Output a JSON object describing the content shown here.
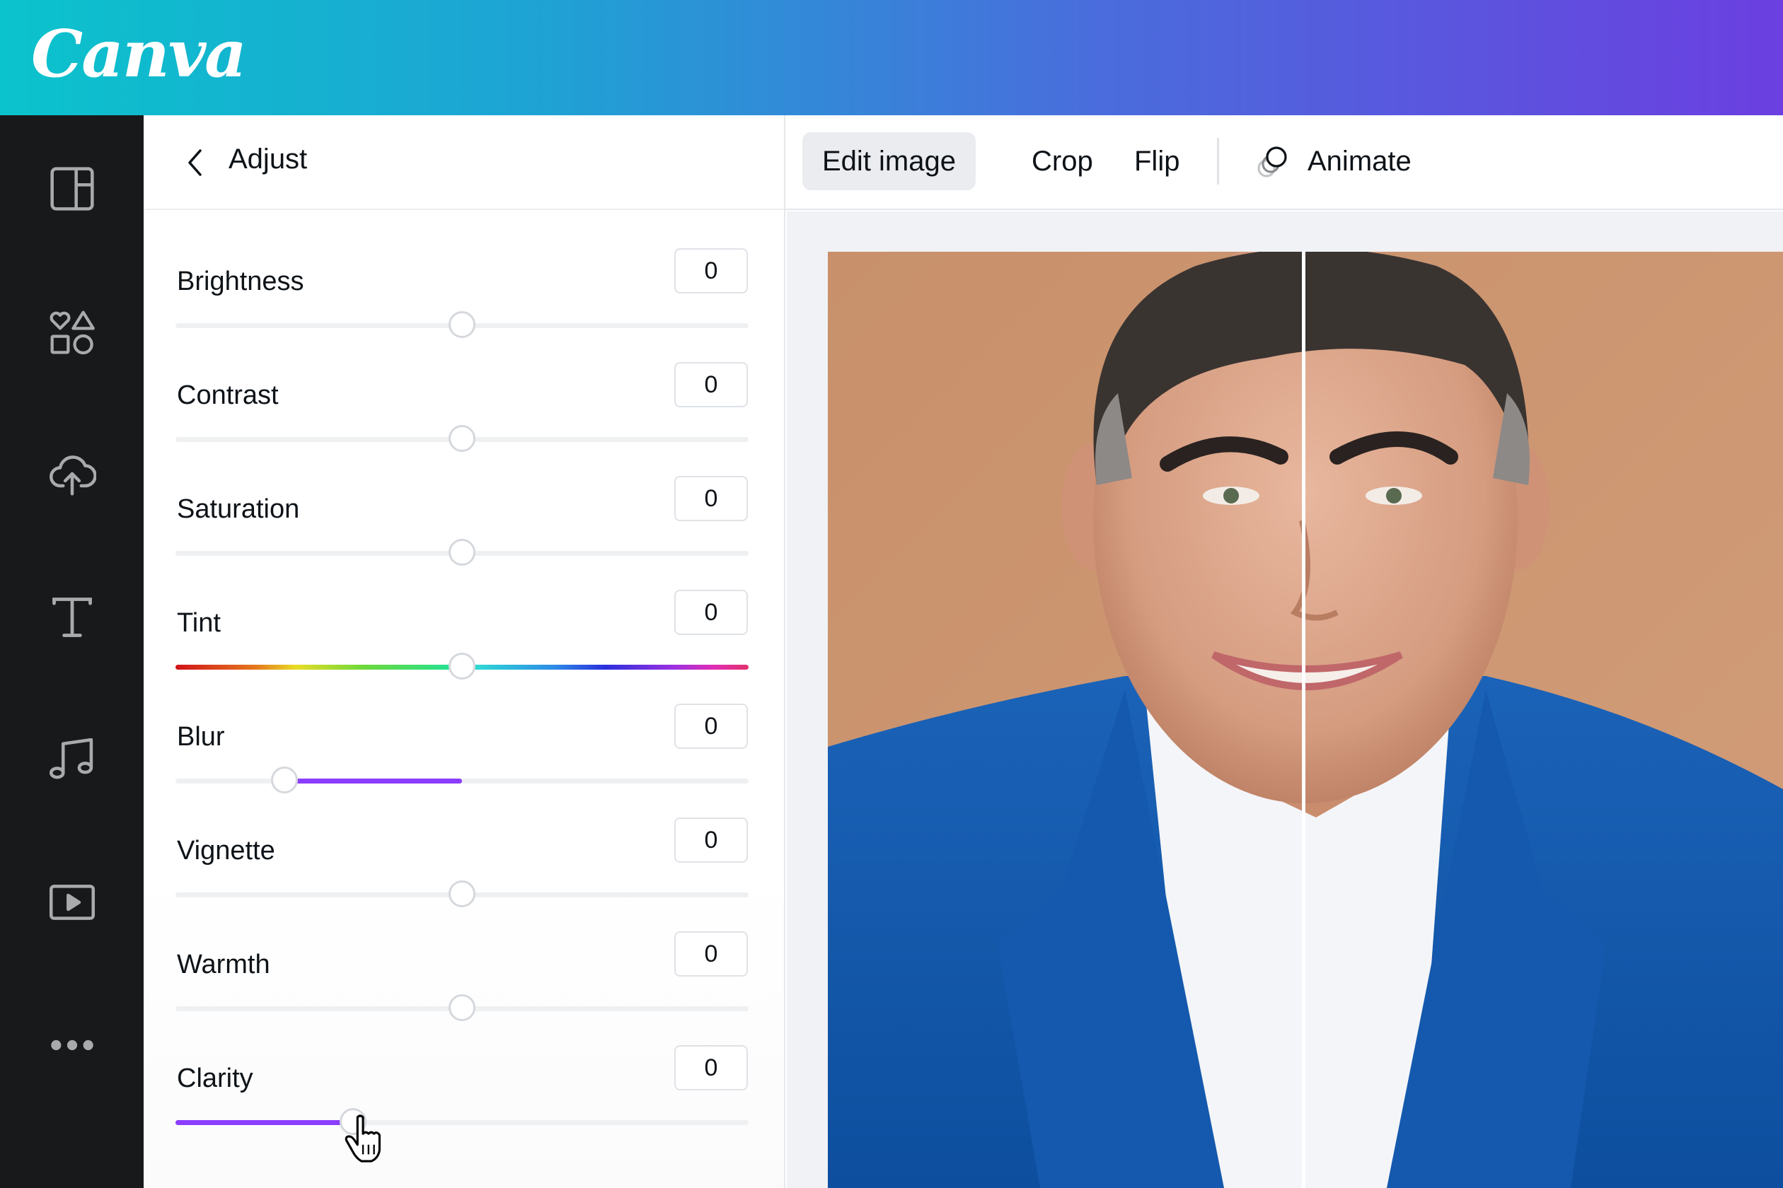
{
  "app": {
    "brand": "Canva",
    "header_gradient": [
      "#0bc3cc",
      "#6b3fe0"
    ]
  },
  "sidebar": {
    "items": [
      {
        "name": "templates",
        "icon": "layout-icon"
      },
      {
        "name": "elements",
        "icon": "shapes-icon"
      },
      {
        "name": "uploads",
        "icon": "cloud-upload-icon"
      },
      {
        "name": "text",
        "icon": "text-icon"
      },
      {
        "name": "audio",
        "icon": "music-icon"
      },
      {
        "name": "videos",
        "icon": "video-icon"
      },
      {
        "name": "more",
        "icon": "more-icon"
      }
    ]
  },
  "panel": {
    "back_label": "back",
    "title": "Adjust",
    "adjustments": [
      {
        "label": "Brightness",
        "value": "0",
        "position": 0.5,
        "style": "neutral"
      },
      {
        "label": "Contrast",
        "value": "0",
        "position": 0.5,
        "style": "neutral"
      },
      {
        "label": "Saturation",
        "value": "0",
        "position": 0.5,
        "style": "neutral"
      },
      {
        "label": "Tint",
        "value": "0",
        "position": 0.5,
        "style": "rainbow"
      },
      {
        "label": "Blur",
        "value": "0",
        "position": 0.19,
        "fill_from": 0.19,
        "fill_to": 0.5,
        "style": "fill"
      },
      {
        "label": "Vignette",
        "value": "0",
        "position": 0.5,
        "style": "neutral"
      },
      {
        "label": "Warmth",
        "value": "0",
        "position": 0.5,
        "style": "neutral"
      },
      {
        "label": "Clarity",
        "value": "0",
        "position": 0.31,
        "fill_from": 0,
        "fill_to": 0.31,
        "style": "fill",
        "cursor": true
      }
    ],
    "accent_color": "#8b3dff"
  },
  "toolbar": {
    "edit_image": "Edit image",
    "crop": "Crop",
    "flip": "Flip",
    "animate": "Animate"
  },
  "canvas": {
    "image_description": "Before/after portrait comparison of smiling man in blue blazer",
    "divider_position": 0.5
  }
}
